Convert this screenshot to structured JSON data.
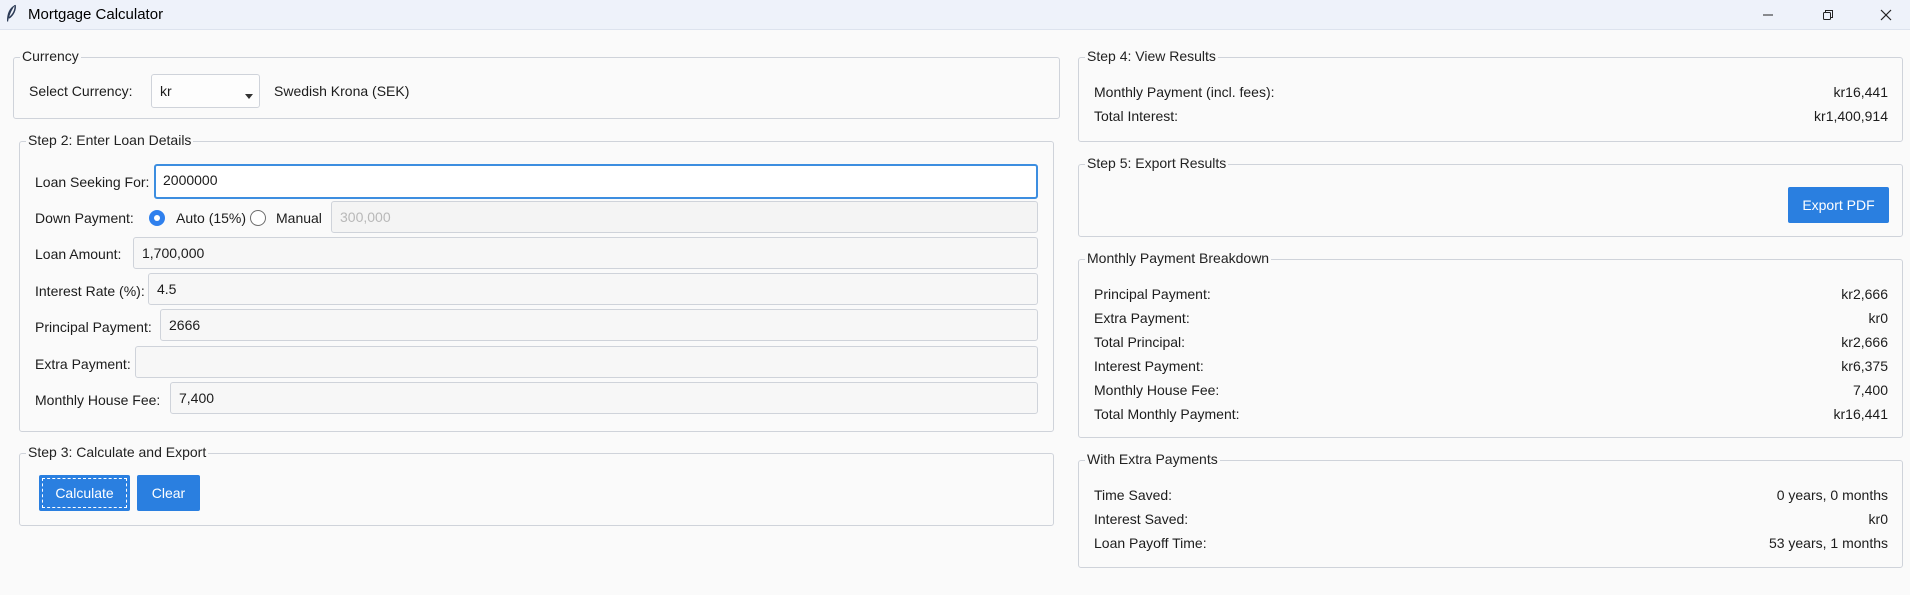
{
  "window": {
    "title": "Mortgage Calculator"
  },
  "currency": {
    "legend": "Currency",
    "label": "Select Currency:",
    "selected": "kr",
    "description": "Swedish Krona (SEK)"
  },
  "step2": {
    "legend": "Step 2: Enter Loan Details",
    "loan_seeking": {
      "label": "Loan Seeking For:",
      "value": "2000000"
    },
    "down_payment": {
      "label": "Down Payment:",
      "auto_label": "Auto (15%)",
      "manual_label": "Manual",
      "selected": "auto",
      "manual_value": "300,000"
    },
    "loan_amount": {
      "label": "Loan Amount:",
      "value": "1,700,000"
    },
    "interest_rate": {
      "label": "Interest Rate (%):",
      "value": "4.5"
    },
    "principal_payment": {
      "label": "Principal Payment:",
      "value": "2666"
    },
    "extra_payment": {
      "label": "Extra Payment:",
      "value": ""
    },
    "house_fee": {
      "label": "Monthly House Fee:",
      "value": "7,400"
    }
  },
  "step3": {
    "legend": "Step 3: Calculate and Export",
    "calculate_label": "Calculate",
    "clear_label": "Clear"
  },
  "step4": {
    "legend": "Step 4: View Results",
    "rows": [
      {
        "label": "Monthly Payment (incl. fees):",
        "value": "kr16,441"
      },
      {
        "label": "Total Interest:",
        "value": "kr1,400,914"
      }
    ]
  },
  "step5": {
    "legend": "Step 5: Export Results",
    "export_label": "Export PDF"
  },
  "breakdown": {
    "legend": "Monthly Payment Breakdown",
    "rows": [
      {
        "label": "Principal Payment:",
        "value": "kr2,666"
      },
      {
        "label": "Extra Payment:",
        "value": "kr0"
      },
      {
        "label": "Total Principal:",
        "value": "kr2,666"
      },
      {
        "label": "Interest Payment:",
        "value": "kr6,375"
      },
      {
        "label": "Monthly House Fee:",
        "value": "7,400"
      },
      {
        "label": "Total Monthly Payment:",
        "value": "kr16,441"
      }
    ]
  },
  "extra": {
    "legend": "With Extra Payments",
    "rows": [
      {
        "label": "Time Saved:",
        "value": "0 years, 0 months"
      },
      {
        "label": "Interest Saved:",
        "value": "kr0"
      },
      {
        "label": "Loan Payoff Time:",
        "value": "53 years, 1 months"
      }
    ]
  },
  "colors": {
    "accent": "#2a7fe0",
    "titlebar": "#eef2fa",
    "focus_border": "#3d8ee0"
  },
  "icons": {
    "app": "feather-icon",
    "minimize": "minimize-icon",
    "restore": "restore-icon",
    "close": "close-icon"
  }
}
